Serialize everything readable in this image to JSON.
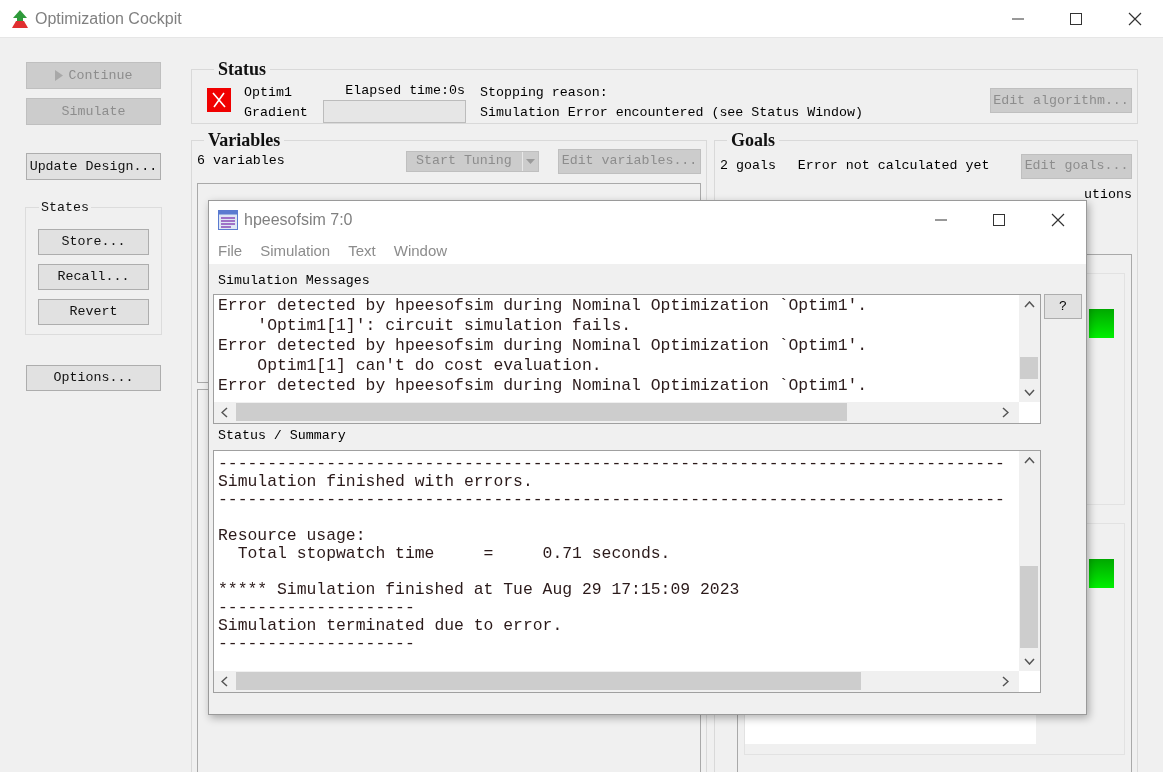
{
  "window": {
    "title": "Optimization Cockpit"
  },
  "left_buttons": [
    {
      "label": "Continue",
      "disabled": true,
      "kind": "play"
    },
    {
      "label": "Simulate",
      "disabled": true,
      "kind": "plain"
    },
    {
      "label": "Update Design...",
      "disabled": false,
      "kind": "plain"
    }
  ],
  "states": {
    "title": "States",
    "buttons": [
      "Store...",
      "Recall...",
      "Revert"
    ]
  },
  "options_button": {
    "label": "Options...",
    "disabled": false
  },
  "status": {
    "title": "Status",
    "failed": true,
    "name": "Optim1",
    "algorithm": "Gradient",
    "elapsed": "Elapsed time:0s",
    "progress": {
      "level": 0
    },
    "stopping_label": "Stopping reason:",
    "stopping_reason": "Simulation Error encountered (see Status Window)",
    "edit_button": {
      "label": "Edit algorithm...",
      "disabled": true
    }
  },
  "variables": {
    "title": "Variables",
    "count": "6 variables",
    "tuning_button": {
      "label": "Start Tuning",
      "disabled": true
    },
    "edit_button": {
      "label": "Edit variables...",
      "disabled": true
    }
  },
  "goals": {
    "title": "Goals",
    "count": "2 goals",
    "error": "Error not calculated yet",
    "edit_button": {
      "label": "Edit goals...",
      "disabled": true
    },
    "partial_text": "utions"
  },
  "dialog": {
    "title": "hpeesofsim 7:0",
    "menu": [
      "File",
      "Simulation",
      "Text",
      "Window"
    ],
    "messages": {
      "label": "Simulation Messages",
      "lines": [
        "Error detected by hpeesofsim during Nominal Optimization `Optim1'.",
        "    'Optim1[1]': circuit simulation fails.",
        "Error detected by hpeesofsim during Nominal Optimization `Optim1'.",
        "    Optim1[1] can't do cost evaluation.",
        "Error detected by hpeesofsim during Nominal Optimization `Optim1'."
      ]
    },
    "help_button": "?",
    "summary": {
      "label": "Status / Summary",
      "blocks": [
        [
          "--------------------------------------------------------------------------------",
          "Simulation finished with errors.",
          "--------------------------------------------------------------------------------"
        ],
        [
          "Resource usage:",
          "  Total stopwatch time     =     0.71 seconds."
        ],
        [
          "***** Simulation finished at Tue Aug 29 17:15:09 2023",
          "--------------------",
          "Simulation terminated due to error.",
          "--------------------"
        ]
      ]
    }
  }
}
